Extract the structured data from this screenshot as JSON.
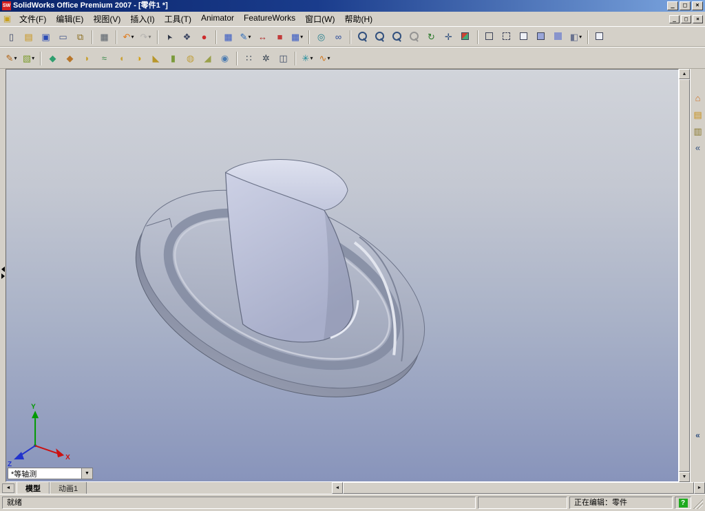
{
  "window": {
    "title": "SolidWorks Office Premium 2007 - [零件1 *]",
    "logo": "SW",
    "minimize": "_",
    "restore": "□",
    "close": "×"
  },
  "menubar": {
    "doc_icon": "▣",
    "items": [
      {
        "name": "menu-file",
        "label": "文件(F)"
      },
      {
        "name": "menu-edit",
        "label": "编辑(E)"
      },
      {
        "name": "menu-view",
        "label": "视图(V)"
      },
      {
        "name": "menu-insert",
        "label": "插入(I)"
      },
      {
        "name": "menu-tools",
        "label": "工具(T)"
      },
      {
        "name": "menu-animator",
        "label": "Animator"
      },
      {
        "name": "menu-featureworks",
        "label": "FeatureWorks"
      },
      {
        "name": "menu-window",
        "label": "窗口(W)"
      },
      {
        "name": "menu-help",
        "label": "帮助(H)"
      }
    ],
    "minimize": "_",
    "restore": "□",
    "close": "×"
  },
  "toolbar_standard": [
    {
      "name": "new-document-icon",
      "cls": "icon",
      "glyph": "▯",
      "color": "#3b4668"
    },
    {
      "name": "open-folder-icon",
      "cls": "icon",
      "glyph": "▤",
      "color": "#c8941a"
    },
    {
      "name": "save-icon",
      "cls": "icon",
      "glyph": "▣",
      "color": "#2b4bb5"
    },
    {
      "name": "make-drawing-from-part-icon",
      "cls": "icon",
      "glyph": "▭",
      "color": "#47598c"
    },
    {
      "name": "make-assembly-from-part-icon",
      "cls": "icon",
      "glyph": "⧉",
      "color": "#8a6d1f"
    },
    {
      "name": "separator",
      "cls": "sep"
    },
    {
      "name": "print-icon",
      "cls": "icon",
      "glyph": "▦",
      "color": "#57606a"
    },
    {
      "name": "separator",
      "cls": "sep"
    },
    {
      "name": "undo-icon",
      "cls": "icon",
      "glyph": "↶",
      "color": "#e07818",
      "dd": "▾"
    },
    {
      "name": "redo-icon",
      "cls": "icon disabled",
      "glyph": "↷",
      "color": "#8c929c",
      "dd": "▾"
    },
    {
      "name": "separator",
      "cls": "sep"
    },
    {
      "name": "select-cursor-icon",
      "cls": "icon g-cursor",
      "glyph": "➤",
      "color": "#2b3242"
    },
    {
      "name": "selection-filter-icon",
      "cls": "icon",
      "glyph": "❖",
      "color": "#3c4662"
    },
    {
      "name": "rebuild-icon",
      "cls": "icon",
      "glyph": "●",
      "color": "#cc2b2b"
    },
    {
      "name": "separator",
      "cls": "sep"
    },
    {
      "name": "sketch-grid-icon",
      "cls": "icon",
      "glyph": "▦",
      "color": "#3558c4"
    },
    {
      "name": "sketch-entities-icon",
      "cls": "icon",
      "glyph": "✎",
      "color": "#2868b8",
      "dd": "▾"
    },
    {
      "name": "smart-dimension-icon",
      "cls": "icon",
      "glyph": "↔",
      "color": "#b02828"
    },
    {
      "name": "photoworks-render-icon",
      "cls": "icon",
      "glyph": "■",
      "color": "#c23a3a"
    },
    {
      "name": "grid-snap-icon",
      "cls": "icon",
      "glyph": "▦",
      "color": "#3558c4",
      "dd": "▾"
    },
    {
      "name": "separator",
      "cls": "sep"
    },
    {
      "name": "select-other-icon",
      "cls": "icon",
      "glyph": "◎",
      "color": "#1a7a8a"
    },
    {
      "name": "hide-show-items-icon",
      "cls": "icon",
      "glyph": "∞",
      "color": "#2a4a9a"
    },
    {
      "name": "separator",
      "cls": "sep"
    },
    {
      "name": "zoom-to-fit-icon",
      "cls": "icon g-zoom"
    },
    {
      "name": "zoom-to-area-icon",
      "cls": "icon g-zoom"
    },
    {
      "name": "zoom-in-out-icon",
      "cls": "icon g-zoom"
    },
    {
      "name": "zoom-to-selection-icon",
      "cls": "icon g-zoom disabled"
    },
    {
      "name": "rotate-view-icon",
      "cls": "icon",
      "glyph": "↻",
      "color": "#2a7a2a"
    },
    {
      "name": "pan-icon",
      "cls": "icon",
      "glyph": "✛",
      "color": "#31507e"
    },
    {
      "name": "standard-views-icon",
      "cls": "icon g-cube g-cube-views",
      "dd": "▾"
    },
    {
      "name": "separator",
      "cls": "sep"
    },
    {
      "name": "wireframe-icon",
      "cls": "icon g-cube g-cube-wire"
    },
    {
      "name": "hidden-lines-visible-icon",
      "cls": "icon g-cube g-cube-hlv"
    },
    {
      "name": "hidden-lines-removed-icon",
      "cls": "icon g-cube g-cube-hlr"
    },
    {
      "name": "shaded-with-edges-icon",
      "cls": "icon g-cube g-cube-shadede"
    },
    {
      "name": "shaded-icon",
      "cls": "icon g-cube g-cube-shaded"
    },
    {
      "name": "section-view-icon",
      "cls": "icon",
      "glyph": "◧",
      "color": "#6a7390",
      "dd": "▾"
    },
    {
      "name": "separator",
      "cls": "sep"
    },
    {
      "name": "view-orientation-icon",
      "cls": "icon g-cube g-cube-hlr"
    }
  ],
  "toolbar_features": [
    {
      "name": "sketch-tools-icon",
      "cls": "icon",
      "glyph": "✎",
      "color": "#b06010",
      "dd": "▾"
    },
    {
      "name": "appearance-tools-icon",
      "cls": "icon",
      "glyph": "▧",
      "color": "#7a9a2a",
      "dd": "▾"
    },
    {
      "name": "separator",
      "cls": "sep"
    },
    {
      "name": "extruded-boss-base-icon",
      "cls": "icon",
      "glyph": "◆",
      "color": "#2f9e6e"
    },
    {
      "name": "extruded-cut-icon",
      "cls": "icon",
      "glyph": "◆",
      "color": "#b8762a"
    },
    {
      "name": "revolved-boss-base-icon",
      "cls": "icon",
      "glyph": "◗",
      "color": "#c8a132"
    },
    {
      "name": "swept-boss-base-icon",
      "cls": "icon",
      "glyph": "≈",
      "color": "#3a8a4a"
    },
    {
      "name": "lofted-boss-base-icon",
      "cls": "icon",
      "glyph": "◖",
      "color": "#caa23a"
    },
    {
      "name": "fillet-icon",
      "cls": "icon",
      "glyph": "◑",
      "color": "#d4a017"
    },
    {
      "name": "chamfer-icon",
      "cls": "icon",
      "glyph": "◣",
      "color": "#b8962a"
    },
    {
      "name": "rib-icon",
      "cls": "icon",
      "glyph": "▮",
      "color": "#7a9a3a"
    },
    {
      "name": "shell-icon",
      "cls": "icon",
      "glyph": "◍",
      "color": "#c0a040"
    },
    {
      "name": "draft-icon",
      "cls": "icon",
      "glyph": "◢",
      "color": "#9aa04a"
    },
    {
      "name": "hole-wizard-icon",
      "cls": "icon",
      "glyph": "◉",
      "color": "#4a7ab0"
    },
    {
      "name": "separator",
      "cls": "sep"
    },
    {
      "name": "linear-pattern-icon",
      "cls": "icon",
      "glyph": "∷",
      "color": "#33404f"
    },
    {
      "name": "circular-pattern-icon",
      "cls": "icon",
      "glyph": "✲",
      "color": "#33404f"
    },
    {
      "name": "mirror-icon",
      "cls": "icon",
      "glyph": "◫",
      "color": "#3c4a66"
    },
    {
      "name": "separator",
      "cls": "sep"
    },
    {
      "name": "reference-geometry-icon",
      "cls": "icon",
      "glyph": "✳",
      "color": "#1a8a9a",
      "dd": "▾"
    },
    {
      "name": "curves-icon",
      "cls": "icon",
      "glyph": "∿",
      "color": "#d07820",
      "dd": "▾"
    }
  ],
  "taskpane": {
    "items": [
      {
        "name": "solidworks-resources-icon",
        "glyph": "⌂",
        "color": "#d07020"
      },
      {
        "name": "design-library-icon",
        "glyph": "▤",
        "color": "#c89018"
      },
      {
        "name": "file-explorer-icon",
        "glyph": "▥",
        "color": "#8a7a30"
      },
      {
        "name": "collapse-taskpane-icon",
        "glyph": "«",
        "color": "#31507e"
      }
    ],
    "lower_chevron": "«"
  },
  "viewport": {
    "view_selector": "*等轴测",
    "dropdown_glyph": "▼",
    "triad": {
      "x": "X",
      "y": "Y",
      "z": "Z"
    }
  },
  "scroll": {
    "up": "▲",
    "down": "▼",
    "left": "◄",
    "right": "►"
  },
  "bottom": {
    "tab_scroll": "◄",
    "tabs": [
      {
        "name": "tab-model",
        "label": "模型",
        "cls": "active"
      },
      {
        "name": "tab-motion-study",
        "label": "动画1",
        "cls": ""
      }
    ]
  },
  "status": {
    "ready": "就绪",
    "editing": "正在编辑：零件",
    "help": "?"
  },
  "colors": {
    "titlebar_left": "#0a246a",
    "titlebar_right": "#7da7e0",
    "chrome": "#d4d0c8",
    "viewport_top": "#d1d4da",
    "viewport_bottom": "#8894bb",
    "model_light": "#dee1ef",
    "model_mid": "#b9bed4",
    "model_dark": "#7d8499",
    "triad_x": "#cc1111",
    "triad_y": "#009a00",
    "triad_z": "#2233cc",
    "status_help_bg": "#1faa1f",
    "logo_red": "#d42020"
  }
}
